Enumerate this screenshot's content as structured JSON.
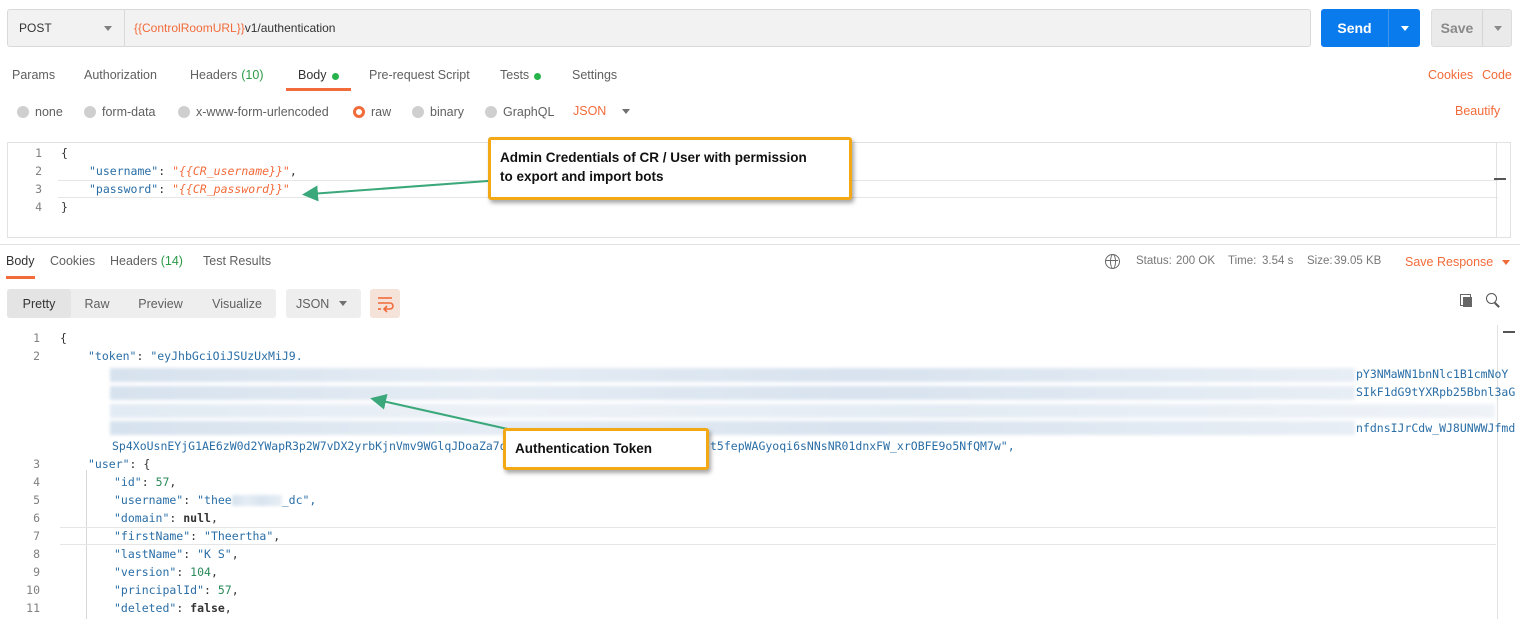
{
  "request": {
    "method": "POST",
    "url_var": "{{ControlRoomURL}}",
    "url_path": "v1/authentication",
    "send_label": "Send",
    "save_label": "Save"
  },
  "tabs": {
    "params": "Params",
    "authorization": "Authorization",
    "headers": "Headers",
    "headers_count": "(10)",
    "body": "Body",
    "prerequest": "Pre-request Script",
    "tests": "Tests",
    "settings": "Settings",
    "cookies": "Cookies",
    "code": "Code"
  },
  "body_types": {
    "none": "none",
    "form_data": "form-data",
    "urlencoded": "x-www-form-urlencoded",
    "raw": "raw",
    "binary": "binary",
    "graphql": "GraphQL",
    "format": "JSON",
    "beautify": "Beautify"
  },
  "request_body": {
    "open": "{",
    "username_key": "\"username\"",
    "username_val": "\"{{CR_username}}\"",
    "password_key": "\"password\"",
    "password_val": "\"{{CR_password}}\"",
    "close": "}"
  },
  "response_tabs": {
    "body": "Body",
    "cookies": "Cookies",
    "headers": "Headers",
    "headers_count": "(14)",
    "test_results": "Test Results"
  },
  "response_meta": {
    "status_label": "Status:",
    "status_value": "200 OK",
    "time_label": "Time:",
    "time_value": "3.54 s",
    "size_label": "Size:",
    "size_value": "39.05 KB",
    "save_response": "Save Response"
  },
  "view_modes": {
    "pretty": "Pretty",
    "raw": "Raw",
    "preview": "Preview",
    "visualize": "Visualize",
    "format": "JSON"
  },
  "response_body": {
    "open": "{",
    "token_key": "\"token\"",
    "token_start": "\"eyJhbGciOiJSUzUxMiJ9.",
    "token_frag1": "pY3NMaWN1bnNlc1B1cmNoY",
    "token_frag2": "SIkF1dG9tYXRpb25Bbnl3aG",
    "token_frag3": "nfdnsIJrCdw_WJ8UNWWJfmd",
    "token_end_left": "Sp4XoUsnEYjG1AE6zW0d2YWapR3p2W7vDX2yrbKjnVmv9WGlqJDoaZa7d3K",
    "token_end_right": "t5fepWAGyoqi6sNNsNR01dnxFW_xrOBFE9o5NfQM7w\",",
    "user_key": "\"user\"",
    "id_key": "\"id\"",
    "id_val": "57",
    "username_key": "\"username\"",
    "username_val_start": "\"thee",
    "username_val_end": "_dc\",",
    "domain_key": "\"domain\"",
    "domain_val": "null",
    "firstname_key": "\"firstName\"",
    "firstname_val": "\"Theertha\"",
    "lastname_key": "\"lastName\"",
    "lastname_val": "\"K S\"",
    "version_key": "\"version\"",
    "version_val": "104",
    "principal_key": "\"principalId\"",
    "principal_val": "57",
    "deleted_key": "\"deleted\"",
    "deleted_val": "false"
  },
  "annotations": {
    "credentials_line1": "Admin Credentials of CR / User with permission",
    "credentials_line2": "to export and import bots",
    "token": "Authentication Token"
  },
  "colors": {
    "accent": "#f26b3a",
    "send": "#097bed",
    "success": "#26b34a",
    "callout_border": "#f3a816"
  }
}
